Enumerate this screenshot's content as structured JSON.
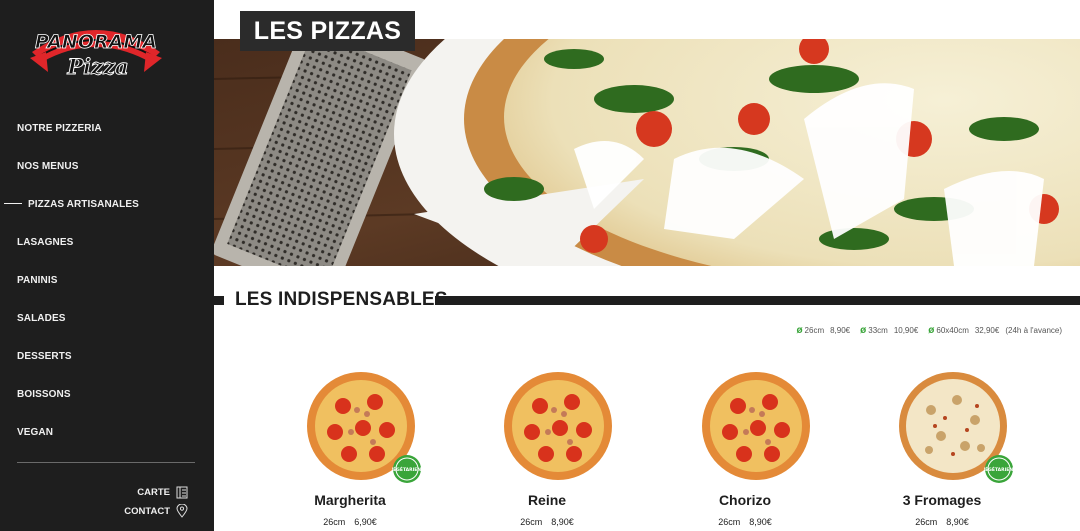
{
  "brand": {
    "logo_top": "Panorama",
    "logo_bottom": "Pizza"
  },
  "sidebar": {
    "items": [
      {
        "label": "NOTRE PIZZERIA",
        "active": false
      },
      {
        "label": "NOS MENUS",
        "active": false
      },
      {
        "label": "PIZZAS ARTISANALES",
        "active": true
      },
      {
        "label": "LASAGNES",
        "active": false
      },
      {
        "label": "PANINIS",
        "active": false
      },
      {
        "label": "SALADES",
        "active": false
      },
      {
        "label": "DESSERTS",
        "active": false
      },
      {
        "label": "BOISSONS",
        "active": false
      },
      {
        "label": "VEGAN",
        "active": false
      }
    ],
    "carte_label": "CARTE",
    "contact_label": "CONTACT"
  },
  "page": {
    "title": "LES PIZZAS"
  },
  "section": {
    "title": "LES INDISPENSABLES"
  },
  "sizes": [
    {
      "size": "26cm",
      "price": "8,90€"
    },
    {
      "size": "33cm",
      "price": "10,90€"
    },
    {
      "size": "60x40cm",
      "price": "32,90€",
      "note": "(24h à l'avance)"
    }
  ],
  "pizzas": [
    {
      "name": "Margherita",
      "size": "26cm",
      "price": "6,90€",
      "badge": "VÉGÉTARIENS"
    },
    {
      "name": "Reine",
      "size": "26cm",
      "price": "8,90€"
    },
    {
      "name": "Chorizo",
      "size": "26cm",
      "price": "8,90€"
    },
    {
      "name": "3 Fromages",
      "size": "26cm",
      "price": "8,90€",
      "badge": "VÉGÉTARIENS"
    }
  ],
  "colors": {
    "sidebar_bg": "#1e1e1e",
    "accent_red": "#e0262a",
    "veg_green": "#3aa53a"
  }
}
